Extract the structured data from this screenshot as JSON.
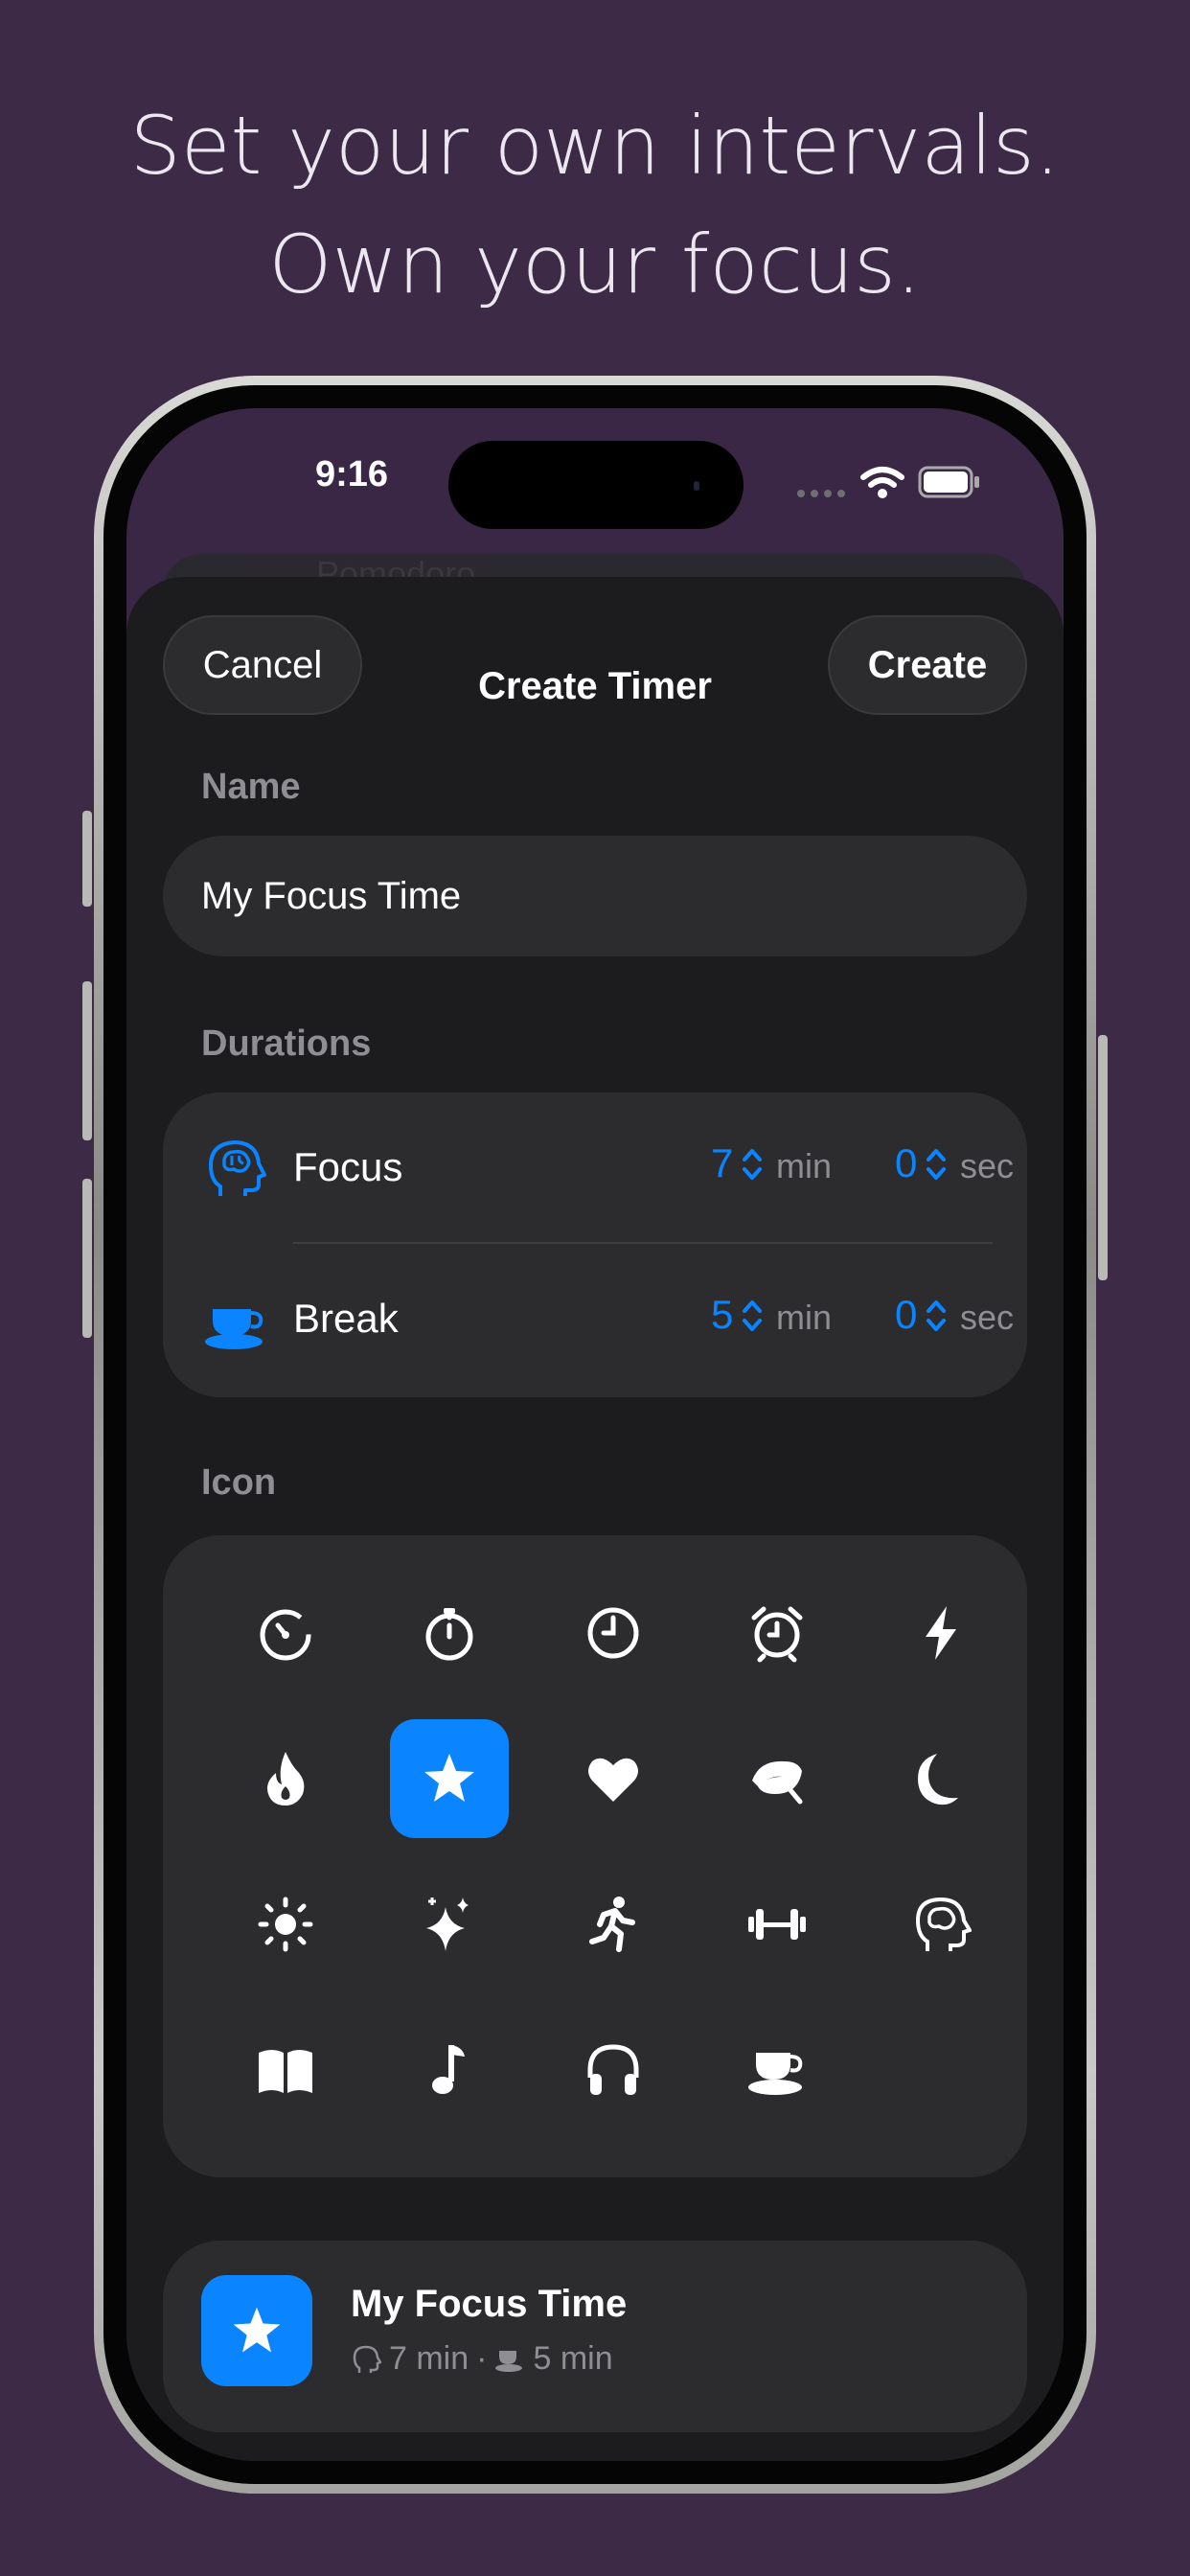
{
  "marketing": {
    "line1": "Set your own intervals.",
    "line2": "Own your focus."
  },
  "status_bar": {
    "time": "9:16",
    "icons": [
      "cellular-icon",
      "wifi-icon",
      "battery-icon"
    ]
  },
  "background_sheet": {
    "title": "Pomodoro"
  },
  "nav": {
    "cancel_label": "Cancel",
    "title": "Create Timer",
    "create_label": "Create"
  },
  "name_section": {
    "label": "Name",
    "value": "My Focus Time",
    "placeholder": "Name"
  },
  "durations": {
    "label": "Durations",
    "rows": [
      {
        "icon": "brain-head-icon",
        "label": "Focus",
        "minutes": "7",
        "min_unit": "min",
        "seconds": "0",
        "sec_unit": "sec"
      },
      {
        "icon": "coffee-cup-icon",
        "label": "Break",
        "minutes": "5",
        "min_unit": "min",
        "seconds": "0",
        "sec_unit": "sec"
      }
    ]
  },
  "icons_section": {
    "label": "Icon",
    "selected": "star-icon",
    "items": [
      "timer-icon",
      "stopwatch-icon",
      "clock-icon",
      "alarm-icon",
      "bolt-icon",
      "flame-icon",
      "star-icon",
      "heart-icon",
      "leaf-icon",
      "moon-icon",
      "sun-icon",
      "sparkles-icon",
      "runner-icon",
      "dumbbell-icon",
      "brain-head-icon",
      "book-icon",
      "music-note-icon",
      "headphones-icon",
      "coffee-cup-icon"
    ]
  },
  "preview": {
    "title": "My Focus Time",
    "focus_text": "7 min",
    "separator": "·",
    "break_text": "5 min"
  },
  "colors": {
    "background": "#3c2a47",
    "accent": "#0a84ff",
    "sheet": "#1c1c1e",
    "card": "#2c2c2e"
  }
}
